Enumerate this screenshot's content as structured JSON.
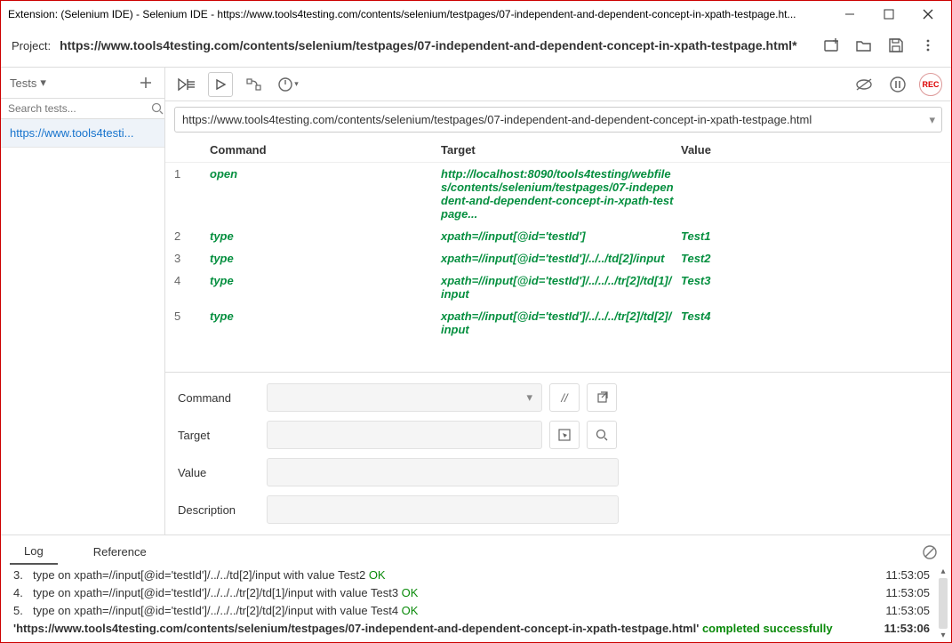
{
  "titlebar": "Extension: (Selenium IDE) - Selenium IDE - https://www.tools4testing.com/contents/selenium/testpages/07-independent-and-dependent-concept-in-xpath-testpage.ht...",
  "project": {
    "label": "Project:",
    "name": "https://www.tools4testing.com/contents/selenium/testpages/07-independent-and-dependent-concept-in-xpath-testpage.html*"
  },
  "sidebar": {
    "header": "Tests",
    "search_placeholder": "Search tests...",
    "items": [
      "https://www.tools4testi..."
    ]
  },
  "url": "https://www.tools4testing.com/contents/selenium/testpages/07-independent-and-dependent-concept-in-xpath-testpage.html",
  "grid": {
    "headers": {
      "command": "Command",
      "target": "Target",
      "value": "Value"
    },
    "rows": [
      {
        "n": "1",
        "command": "open",
        "target": "http://localhost:8090/tools4testing/webfiles/contents/selenium/testpages/07-independent-and-dependent-concept-in-xpath-testpage...",
        "value": ""
      },
      {
        "n": "2",
        "command": "type",
        "target": "xpath=//input[@id='testId']",
        "value": "Test1"
      },
      {
        "n": "3",
        "command": "type",
        "target": "xpath=//input[@id='testId']/../../td[2]/input",
        "value": "Test2"
      },
      {
        "n": "4",
        "command": "type",
        "target": "xpath=//input[@id='testId']/../../../tr[2]/td[1]/input",
        "value": "Test3"
      },
      {
        "n": "5",
        "command": "type",
        "target": "xpath=//input[@id='testId']/../../../tr[2]/td[2]/input",
        "value": "Test4"
      }
    ]
  },
  "form": {
    "command_label": "Command",
    "target_label": "Target",
    "value_label": "Value",
    "description_label": "Description"
  },
  "tabs": {
    "log": "Log",
    "reference": "Reference"
  },
  "log": {
    "rows": [
      {
        "n": "3.",
        "msg_pre": "type on xpath=//input[@id='testId']/../../td[2]/input with value Test2 ",
        "ok": "OK",
        "time": "11:53:05"
      },
      {
        "n": "4.",
        "msg_pre": "type on xpath=//input[@id='testId']/../../../tr[2]/td[1]/input with value Test3 ",
        "ok": "OK",
        "time": "11:53:05"
      },
      {
        "n": "5.",
        "msg_pre": "type on xpath=//input[@id='testId']/../../../tr[2]/td[2]/input with value Test4 ",
        "ok": "OK",
        "time": "11:53:05"
      }
    ],
    "final_pre": "'https://www.tools4testing.com/contents/selenium/testpages/07-independent-and-dependent-concept-in-xpath-testpage.html' ",
    "final_ok": "completed successfully",
    "final_time": "11:53:06"
  },
  "rec_label": "REC"
}
